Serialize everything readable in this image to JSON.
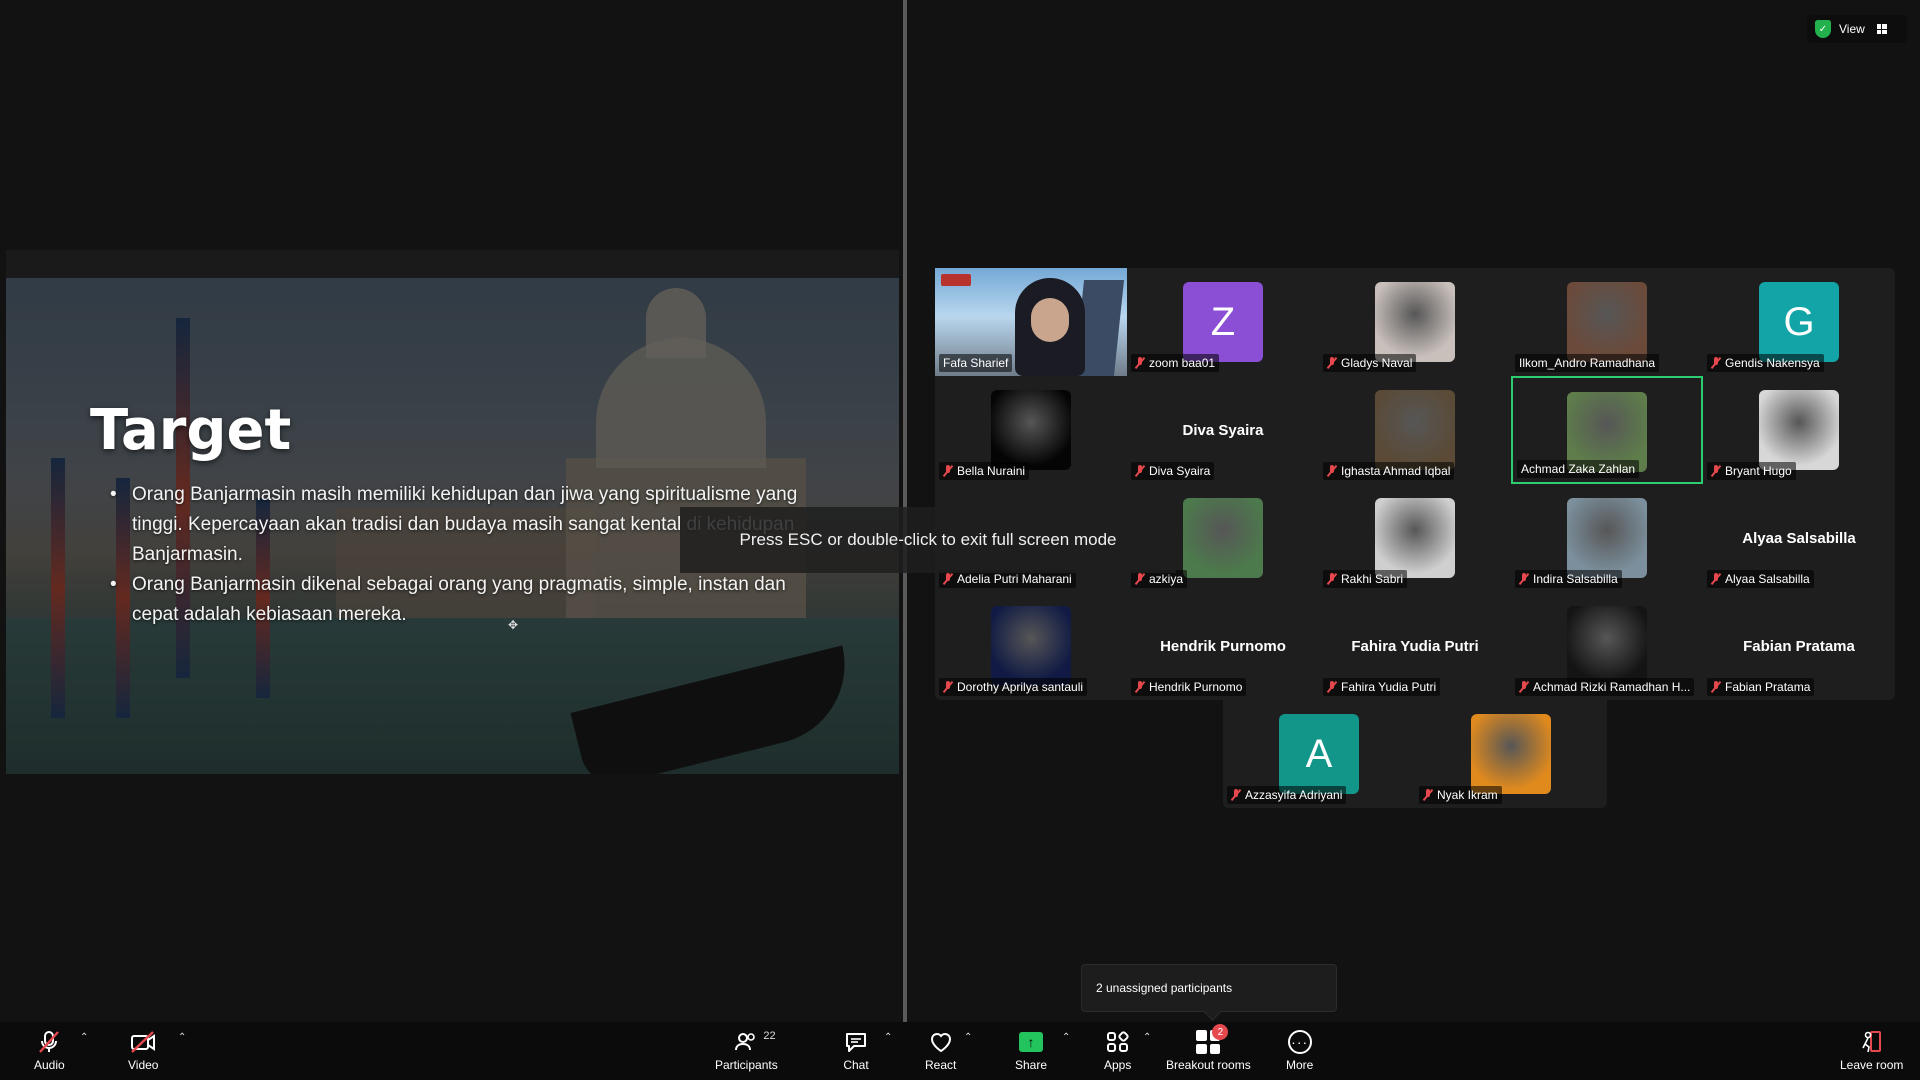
{
  "share": {
    "slide_title": "Target",
    "bullets": [
      "Orang Banjarmasin masih memiliki kehidupan dan jiwa yang spiritualisme yang tinggi. Kepercayaan akan tradisi dan budaya masih sangat kental di kehidupan Banjarmasin.",
      "Orang Banjarmasin dikenal sebagai orang yang pragmatis, simple, instan dan cepat adalah kebiasaan mereka."
    ]
  },
  "toast": "Press ESC or double-click to exit full screen mode",
  "view_button": {
    "label": "View"
  },
  "participants": [
    {
      "name": "Fafa Sharief",
      "type": "video",
      "muted": false
    },
    {
      "name": "zoom baa01",
      "type": "letter",
      "letter": "Z",
      "color": "#8b4fd6",
      "muted": true
    },
    {
      "name": "Gladys Naval",
      "type": "photo",
      "color": "#c9c0bc",
      "muted": true
    },
    {
      "name": "Ilkom_Andro Ramadhana",
      "type": "photo",
      "color": "#6b4a3a",
      "muted": false
    },
    {
      "name": "Gendis Nakensya",
      "type": "letter",
      "letter": "G",
      "color": "#12a4a6",
      "muted": true
    },
    {
      "name": "Bella Nuraini",
      "type": "photo",
      "color": "#050505",
      "muted": true
    },
    {
      "name": "Diva Syaira",
      "type": "name",
      "big_name": "Diva Syaira",
      "muted": true
    },
    {
      "name": "Ighasta Ahmad Iqbal",
      "type": "photo",
      "color": "#5a4a36",
      "muted": true
    },
    {
      "name": "Achmad Zaka Zahlan",
      "type": "photo",
      "color": "#5e7d4b",
      "muted": false,
      "active": true
    },
    {
      "name": "Bryant Hugo",
      "type": "photo",
      "color": "#d7d7d7",
      "muted": true
    },
    {
      "name": "Adelia Putri Maharani",
      "type": "hidden",
      "muted": true
    },
    {
      "name": "azkiya",
      "type": "photo",
      "color": "#4c7a4c",
      "muted": true
    },
    {
      "name": "Rakhi Sabri",
      "type": "photo",
      "color": "#cfcfcf",
      "muted": true
    },
    {
      "name": "Indira Salsabilla",
      "type": "photo",
      "color": "#7b8f9c",
      "muted": true
    },
    {
      "name": "Alyaa Salsabilla",
      "type": "name",
      "big_name": "Alyaa Salsabilla",
      "muted": true
    },
    {
      "name": "Dorothy Aprilya santauli",
      "type": "photo",
      "color": "#101a44",
      "muted": true
    },
    {
      "name": "Hendrik Purnomo",
      "type": "name",
      "big_name": "Hendrik Purnomo",
      "muted": true
    },
    {
      "name": "Fahira Yudia Putri",
      "type": "name",
      "big_name": "Fahira Yudia Putri",
      "muted": true
    },
    {
      "name": "Achmad Rizki Ramadhan H...",
      "type": "photo",
      "color": "#141414",
      "muted": true
    },
    {
      "name": "Fabian Pratama",
      "type": "name",
      "big_name": "Fabian Pratama",
      "muted": true
    },
    {
      "name": "Azzasyifa Adriyani",
      "type": "letter",
      "letter": "A",
      "color": "#12968a",
      "muted": true
    },
    {
      "name": "Nyak Ikram",
      "type": "photo",
      "color": "#e08a1e",
      "muted": true
    }
  ],
  "unassigned": "2 unassigned participants",
  "toolbar": {
    "audio": "Audio",
    "video": "Video",
    "participants": "Participants",
    "participants_count": "22",
    "chat": "Chat",
    "react": "React",
    "share": "Share",
    "apps": "Apps",
    "breakout": "Breakout rooms",
    "breakout_badge": "2",
    "more": "More",
    "leave": "Leave room"
  }
}
